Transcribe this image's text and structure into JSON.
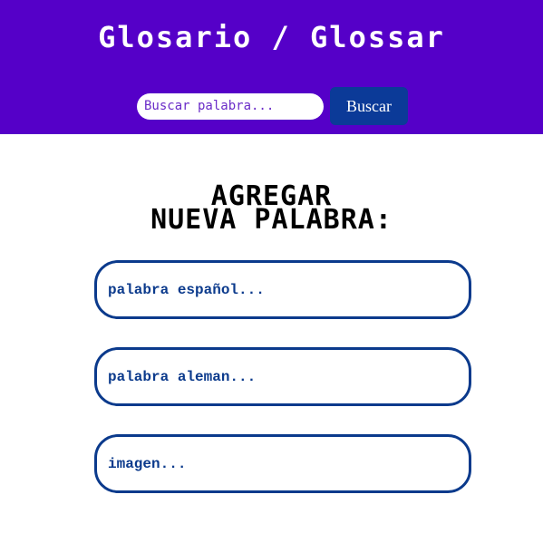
{
  "header": {
    "title": "Glosario / Glossar",
    "search": {
      "placeholder": "Buscar palabra...",
      "button_label": "Buscar"
    }
  },
  "form": {
    "title_line1": "AGREGAR",
    "title_line2": "NUEVA PALABRA:",
    "fields": [
      {
        "placeholder": "palabra español..."
      },
      {
        "placeholder": "palabra aleman..."
      },
      {
        "placeholder": "imagen..."
      }
    ]
  },
  "colors": {
    "header_bg": "#5500c8",
    "button_bg": "#0b3a98",
    "field_border": "#0b3a8c"
  }
}
